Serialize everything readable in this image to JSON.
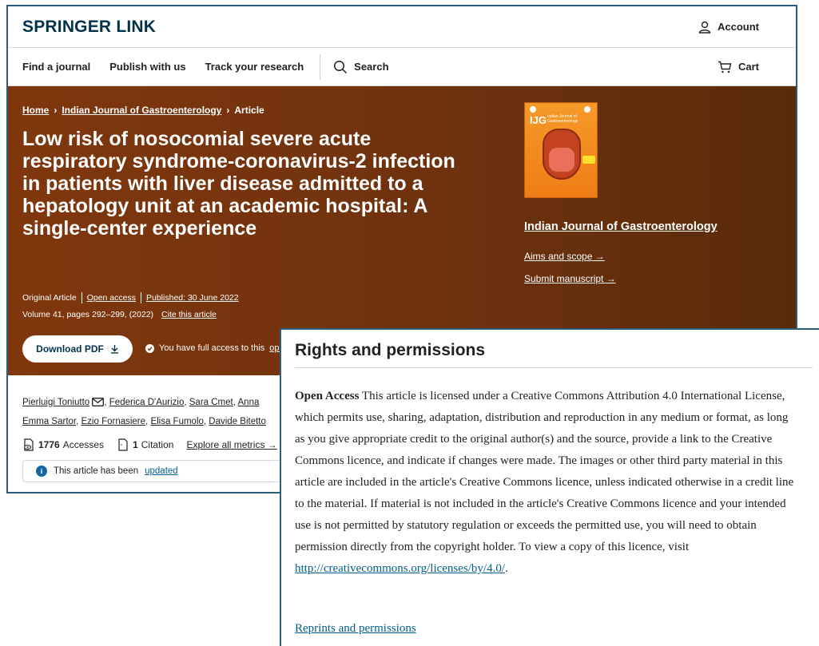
{
  "header": {
    "logo": "SPRINGER LINK",
    "account": "Account"
  },
  "nav": {
    "items": [
      "Find a journal",
      "Publish with us",
      "Track your research"
    ],
    "search": "Search",
    "cart": "Cart"
  },
  "breadcrumb": {
    "home": "Home",
    "journal": "Indian Journal of Gastroenterology",
    "current": "Article"
  },
  "article": {
    "title": "Low risk of nosocomial severe acute respiratory syndrome-coronavirus-2 infection in patients with liver disease admitted to a hepatology unit at an academic hospital: A single-center experience",
    "type": "Original Article",
    "access": "Open access",
    "published": "Published: 30 June 2022",
    "volume": "Volume 41, pages 292–299, (2022)",
    "cite": "Cite this article",
    "download": "Download PDF",
    "access_msg_prefix": "You have full access to this",
    "access_msg_link": "open"
  },
  "journal": {
    "cover_abbr": "IJG",
    "cover_name": "Indian Journal of Gastroenterology",
    "name": "Indian Journal of Gastroenterology",
    "aims": "Aims and scope →",
    "submit": "Submit manuscript →"
  },
  "authors": {
    "line1": [
      "Pierluigi Toniutto",
      "Federica D'Aurizio",
      "Sara Cmet",
      "Anna"
    ],
    "line2": [
      "Emma Sartor",
      "Ezio Fornasiere",
      "Elisa Fumolo",
      "Davide Bitetto"
    ]
  },
  "metrics": {
    "accesses_count": "1776",
    "accesses_label": "Accesses",
    "citations_count": "1",
    "citations_label": "Citation",
    "explore": "Explore all metrics →"
  },
  "notice": {
    "text": "This article has been",
    "link": "updated"
  },
  "rights": {
    "heading": "Rights and permissions",
    "lead": "Open Access",
    "text": "This article is licensed under a Creative Commons Attribution 4.0 International License, which permits use, sharing, adaptation, distribution and reproduction in any medium or format, as long as you give appropriate credit to the original author(s) and the source, provide a link to the Creative Commons licence, and indicate if changes were made. The images or other third party material in this article are included in the article's Creative Commons licence, unless indicated otherwise in a credit line to the material. If material is not included in the article's Creative Commons licence and your intended use is not permitted by statutory regulation or exceeds the permitted use, you will need to obtain permission directly from the copyright holder. To view a copy of this licence, visit",
    "url": "http://creativecommons.org/licenses/by/4.0/",
    "end": ".",
    "reprints": "Reprints and permissions"
  }
}
